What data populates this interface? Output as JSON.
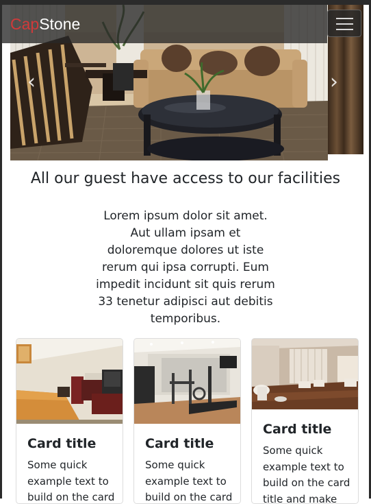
{
  "navbar": {
    "brand_prefix": "Cap",
    "brand_suffix": "Stone"
  },
  "carousel": {
    "prev_label": "‹",
    "next_label": "›"
  },
  "section": {
    "heading": "All our guest have access to our facilities",
    "text": "Lorem ipsum dolor sit amet. Aut ullam ipsam et doloremque dolores ut iste rerum qui ipsa corrupti. Eum impedit incidunt sit quis rerum 33 tenetur adipisci aut debitis temporibus."
  },
  "cards": [
    {
      "title": "Card title",
      "text": "Some quick example text to build on the card"
    },
    {
      "title": "Card title",
      "text": "Some quick example text to build on the card"
    },
    {
      "title": "Card title",
      "text": "Some quick example text to build on the card title and make"
    }
  ],
  "colors": {
    "brand_accent": "#d13a3a",
    "navbar_bg": "#282828"
  }
}
